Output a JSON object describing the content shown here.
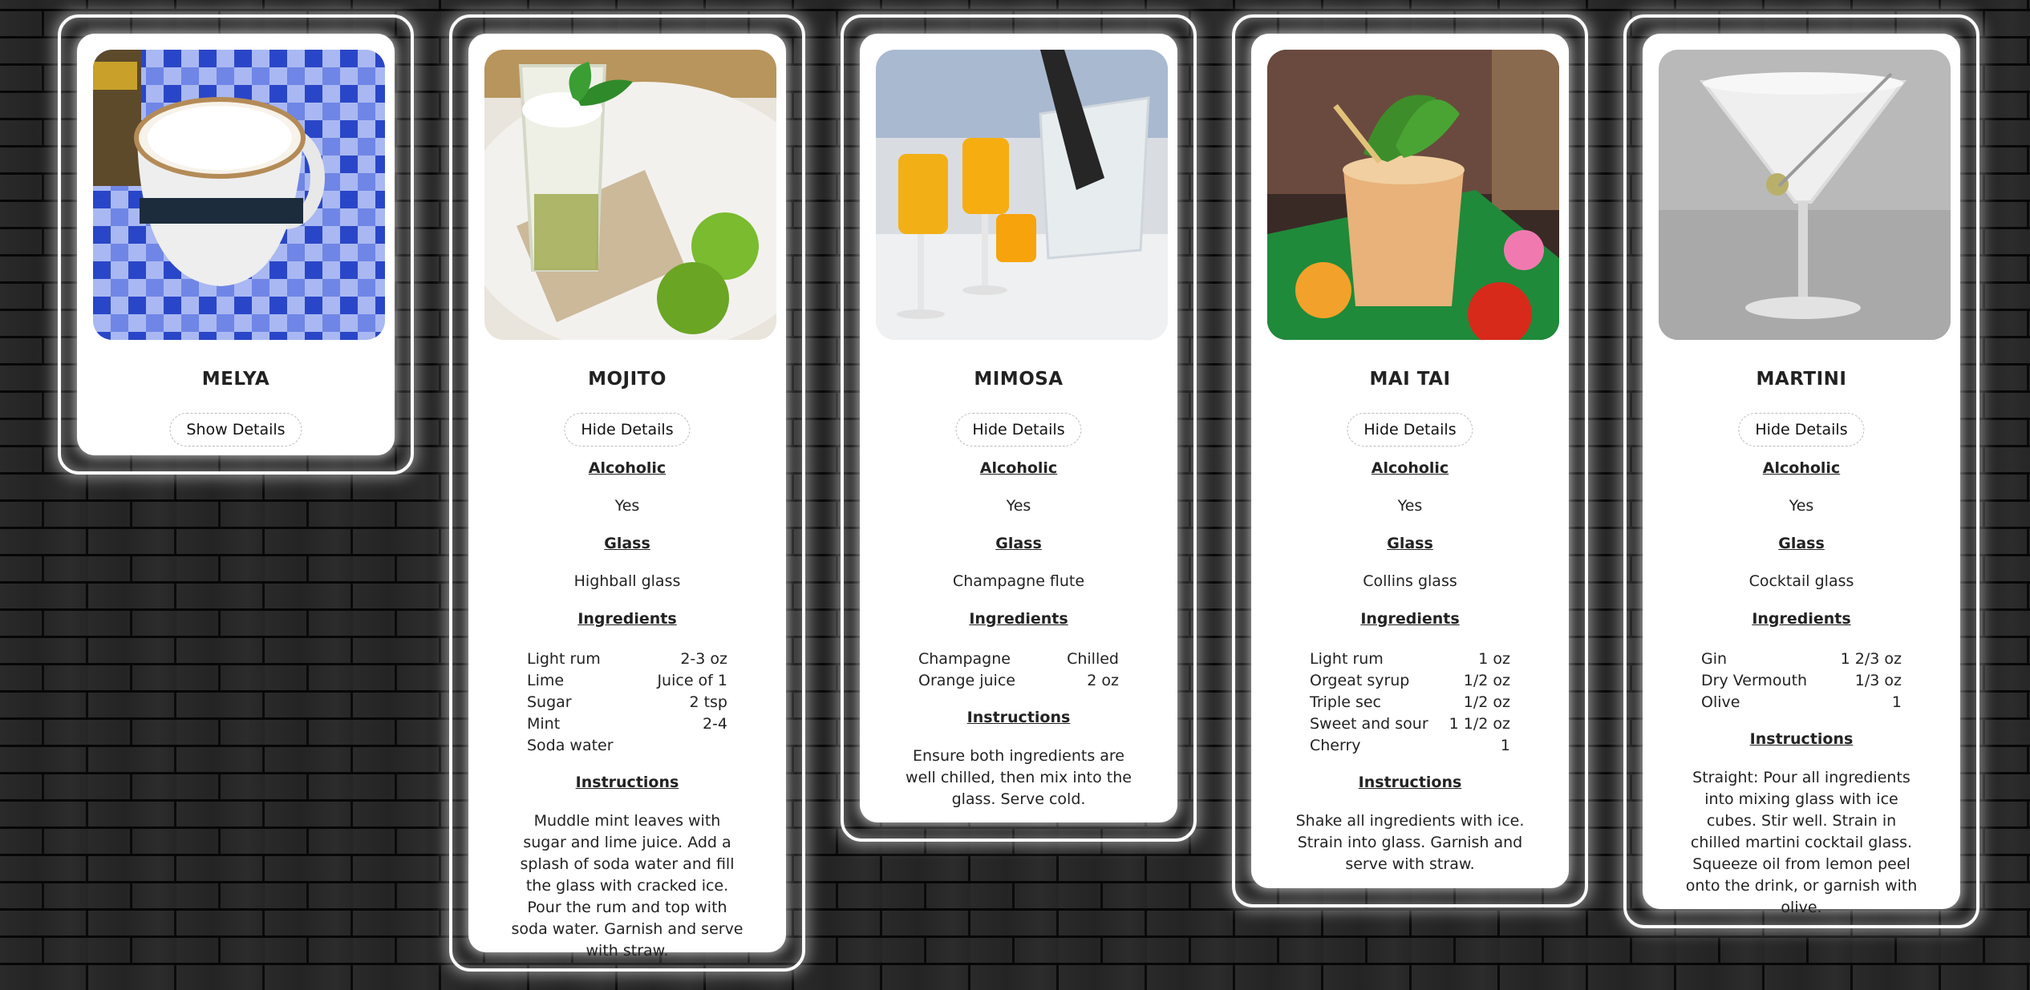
{
  "cards": [
    {
      "name": "MELYA",
      "toggle_label": "Show Details"
    },
    {
      "name": "MOJITO",
      "toggle_label": "Hide Details",
      "alcoholic_heading": "Alcoholic",
      "alcoholic": "Yes",
      "glass_heading": "Glass",
      "glass": "Highball glass",
      "ingredients_heading": "Ingredients",
      "ingredients": [
        {
          "name": "Light rum",
          "amount": "2-3 oz"
        },
        {
          "name": "Lime",
          "amount": "Juice of 1"
        },
        {
          "name": "Sugar",
          "amount": "2 tsp"
        },
        {
          "name": "Mint",
          "amount": "2-4"
        },
        {
          "name": "Soda water",
          "amount": ""
        }
      ],
      "instructions_heading": "Instructions",
      "instructions": "Muddle mint leaves with sugar and lime juice. Add a splash of soda water and fill the glass with cracked ice. Pour the rum and top with soda water. Garnish and serve with straw."
    },
    {
      "name": "MIMOSA",
      "toggle_label": "Hide Details",
      "alcoholic_heading": "Alcoholic",
      "alcoholic": "Yes",
      "glass_heading": "Glass",
      "glass": "Champagne flute",
      "ingredients_heading": "Ingredients",
      "ingredients": [
        {
          "name": "Champagne",
          "amount": "Chilled"
        },
        {
          "name": "Orange juice",
          "amount": "2 oz"
        }
      ],
      "instructions_heading": "Instructions",
      "instructions": "Ensure both ingredients are well chilled, then mix into the glass. Serve cold."
    },
    {
      "name": "MAI TAI",
      "toggle_label": "Hide Details",
      "alcoholic_heading": "Alcoholic",
      "alcoholic": "Yes",
      "glass_heading": "Glass",
      "glass": "Collins glass",
      "ingredients_heading": "Ingredients",
      "ingredients": [
        {
          "name": "Light rum",
          "amount": "1 oz"
        },
        {
          "name": "Orgeat syrup",
          "amount": "1/2 oz"
        },
        {
          "name": "Triple sec",
          "amount": "1/2 oz"
        },
        {
          "name": "Sweet and sour",
          "amount": "1 1/2 oz"
        },
        {
          "name": "Cherry",
          "amount": "1"
        }
      ],
      "instructions_heading": "Instructions",
      "instructions": "Shake all ingredients with ice. Strain into glass. Garnish and serve with straw."
    },
    {
      "name": "MARTINI",
      "toggle_label": "Hide Details",
      "alcoholic_heading": "Alcoholic",
      "alcoholic": "Yes",
      "glass_heading": "Glass",
      "glass": "Cocktail glass",
      "ingredients_heading": "Ingredients",
      "ingredients": [
        {
          "name": "Gin",
          "amount": "1 2/3 oz"
        },
        {
          "name": "Dry Vermouth",
          "amount": "1/3 oz"
        },
        {
          "name": "Olive",
          "amount": "1"
        }
      ],
      "instructions_heading": "Instructions",
      "instructions": "Straight: Pour all ingredients into mixing glass with ice cubes. Stir well. Strain in chilled martini cocktail glass. Squeeze oil from lemon peel onto the drink, or garnish with olive."
    }
  ],
  "colors": {
    "card_background": "#ffffff",
    "neon_border": "#fbfbfb",
    "wall": "#1c1c1c"
  }
}
